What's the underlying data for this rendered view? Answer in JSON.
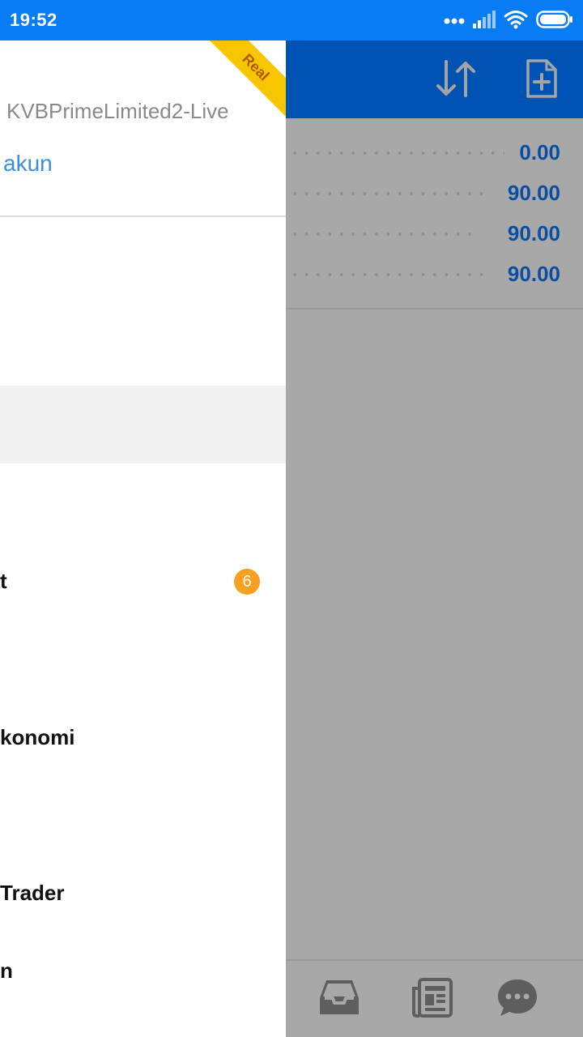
{
  "status_bar": {
    "time": "19:52"
  },
  "drawer": {
    "ribbon_label": "Real",
    "server_name": "KVBPrimeLimited2-Live",
    "account_link": "akun",
    "menu_items": [
      {
        "label": "t",
        "badge": "6"
      },
      {
        "label": "konomi"
      },
      {
        "label": "Trader"
      },
      {
        "label": "n"
      }
    ]
  },
  "main": {
    "values": [
      "0.00",
      "90.00",
      "90.00",
      "90.00"
    ]
  },
  "colors": {
    "status_bar": "#087cf4",
    "header": "#0053b3",
    "value_text": "#0a4ea3",
    "overlay": "#a8a8a8",
    "ribbon": "#f7c600",
    "badge": "#f7a021",
    "link": "#3a8fe0"
  },
  "icons": {
    "header": [
      "sort-arrows-icon",
      "new-document-icon"
    ],
    "bottom": [
      "inbox-icon",
      "news-icon",
      "chat-icon"
    ],
    "status": [
      "signal-dots-icon",
      "cell-signal-icon",
      "wifi-icon",
      "battery-icon"
    ]
  }
}
